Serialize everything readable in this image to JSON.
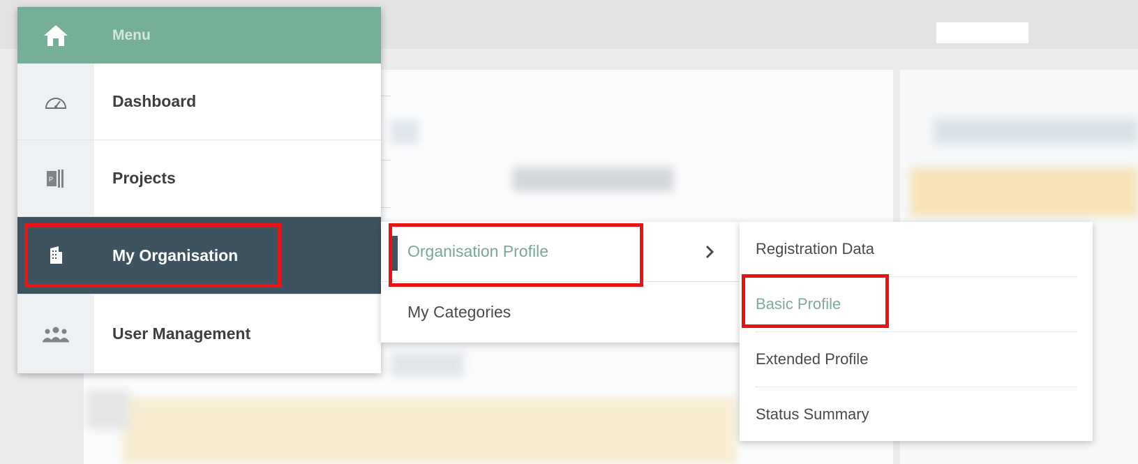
{
  "menu": {
    "header_label": "Menu",
    "items": [
      {
        "label": "Dashboard",
        "icon": "dashboard-gauge-icon"
      },
      {
        "label": "Projects",
        "icon": "project-file-icon"
      },
      {
        "label": "My Organisation",
        "icon": "building-icon"
      },
      {
        "label": "User Management",
        "icon": "users-group-icon"
      }
    ],
    "active_item": "My Organisation"
  },
  "submenu": {
    "items": [
      {
        "label": "Organisation Profile",
        "has_children": true
      },
      {
        "label": "My Categories",
        "has_children": false
      }
    ]
  },
  "profile_submenu": {
    "items": [
      {
        "label": "Registration Data"
      },
      {
        "label": "Basic Profile"
      },
      {
        "label": "Extended Profile"
      },
      {
        "label": "Status Summary"
      }
    ],
    "selected_item": "Basic Profile"
  },
  "colors": {
    "menu_header": "#76ae98",
    "active_item": "#3e5360",
    "accent_text": "#7aa894",
    "highlight": "#ee1111"
  }
}
